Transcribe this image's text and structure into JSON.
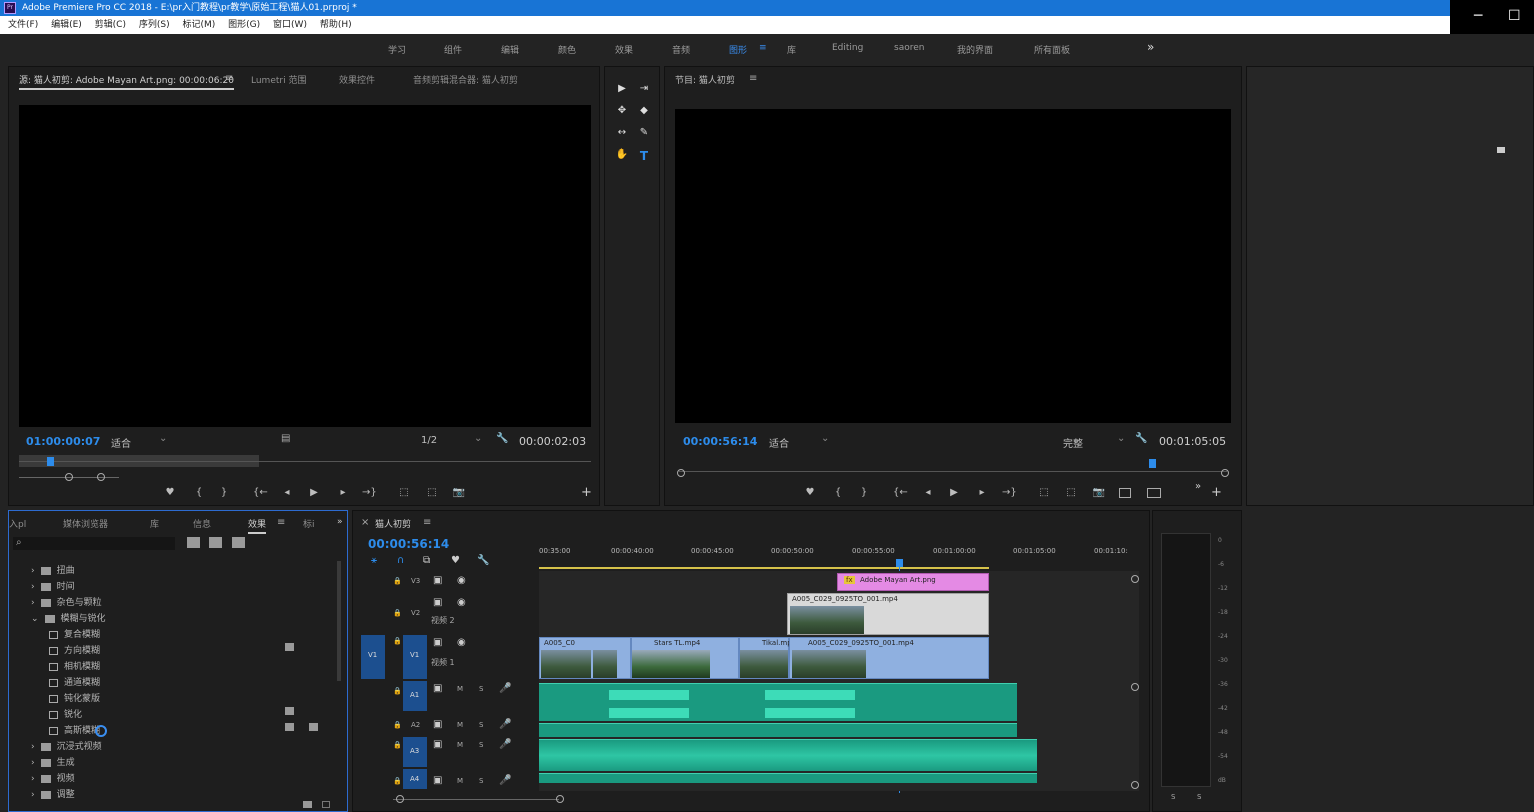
{
  "window": {
    "title": "Adobe Premiere Pro CC 2018 - E:\\pr入门教程\\pr教学\\原始工程\\猫人01.prproj *",
    "app_icon": "Pr",
    "minimize": "─",
    "maximize": "☐"
  },
  "menu": [
    "文件(F)",
    "编辑(E)",
    "剪辑(C)",
    "序列(S)",
    "标记(M)",
    "图形(G)",
    "窗口(W)",
    "帮助(H)"
  ],
  "workspaces": [
    "学习",
    "组件",
    "编辑",
    "颜色",
    "效果",
    "音频",
    "图形",
    "库",
    "Editing",
    "saoren",
    "我的界面",
    "所有面板",
    "»"
  ],
  "workspace_active": "图形",
  "source_panel": {
    "tabs": [
      "源: 猫人初剪: Adobe Mayan Art.png: 00:00:06:20",
      "Lumetri 范围",
      "效果控件",
      "音频剪辑混合器: 猫人初剪"
    ],
    "timecode": "01:00:00:07",
    "fit": "适合",
    "resolution": "1/2",
    "duration": "00:00:02:03"
  },
  "tools": [
    "▶",
    "⇥",
    "✥",
    "◆",
    "↔",
    "✎",
    "✋",
    "T"
  ],
  "program_panel": {
    "tab": "节目: 猫人初剪",
    "timecode": "00:00:56:14",
    "fit": "适合",
    "quality": "完整",
    "duration": "00:01:05:05"
  },
  "transport": [
    "♥",
    "{",
    "}",
    "{←",
    "◂",
    "▶",
    "▸",
    "→}",
    "⬚",
    "⬚",
    "📷"
  ],
  "effects_panel": {
    "tabs": [
      "入pl",
      "媒体浏览器",
      "库",
      "信息",
      "效果",
      "标i",
      "»"
    ],
    "active_tab": "效果",
    "search_placeholder": "",
    "tree": [
      {
        "label": "扭曲",
        "type": "folder"
      },
      {
        "label": "时间",
        "type": "folder"
      },
      {
        "label": "杂色与颗粒",
        "type": "folder"
      },
      {
        "label": "模糊与锐化",
        "type": "folder-open"
      },
      {
        "label": "复合模糊",
        "type": "effect"
      },
      {
        "label": "方向模糊",
        "type": "effect"
      },
      {
        "label": "相机模糊",
        "type": "effect"
      },
      {
        "label": "通道模糊",
        "type": "effect"
      },
      {
        "label": "钝化蒙版",
        "type": "effect"
      },
      {
        "label": "锐化",
        "type": "effect"
      },
      {
        "label": "高斯模糊",
        "type": "effect"
      },
      {
        "label": "沉浸式视频",
        "type": "folder"
      },
      {
        "label": "生成",
        "type": "folder"
      },
      {
        "label": "视频",
        "type": "folder"
      },
      {
        "label": "调整",
        "type": "folder"
      }
    ]
  },
  "timeline": {
    "tab": "猫人初剪",
    "timecode": "00:00:56:14",
    "ruler": [
      "00:35:00",
      "00:00:40:00",
      "00:00:45:00",
      "00:00:50:00",
      "00:00:55:00",
      "00:01:00:00",
      "00:01:05:00",
      "00:01:10:"
    ],
    "playhead_fraction": 0.6,
    "tracks": {
      "video": [
        {
          "name": "V3",
          "label": ""
        },
        {
          "name": "V2",
          "label": "视频 2"
        },
        {
          "name": "V1",
          "label": "视频 1",
          "source": "V1"
        }
      ],
      "audio": [
        {
          "name": "A1",
          "m": "M",
          "s": "S"
        },
        {
          "name": "A2",
          "m": "M",
          "s": "S"
        },
        {
          "name": "A3",
          "m": "M",
          "s": "S"
        },
        {
          "name": "A4",
          "m": "M",
          "s": "S"
        }
      ]
    },
    "clips": {
      "v3": "Adobe Mayan Art.png",
      "v2": "A005_C029_0925TO_001.mp4",
      "v1": [
        "A005_C0",
        "Stars TL.mp4",
        "Tikal.mp",
        "A005_C029_0925TO_001.mp4"
      ]
    }
  },
  "audio_meter": {
    "ticks": [
      "0",
      "-6",
      "-12",
      "-18",
      "-24",
      "-30",
      "-36",
      "-42",
      "-48",
      "-54",
      "dB"
    ],
    "solo": [
      "S",
      "S"
    ]
  },
  "colors": {
    "accent": "#2d8ceb",
    "titlebar": "#1874d5",
    "clip_video": "#8fb0e0",
    "clip_graphic": "#e48ae4",
    "clip_audio": "#1a9a80"
  }
}
